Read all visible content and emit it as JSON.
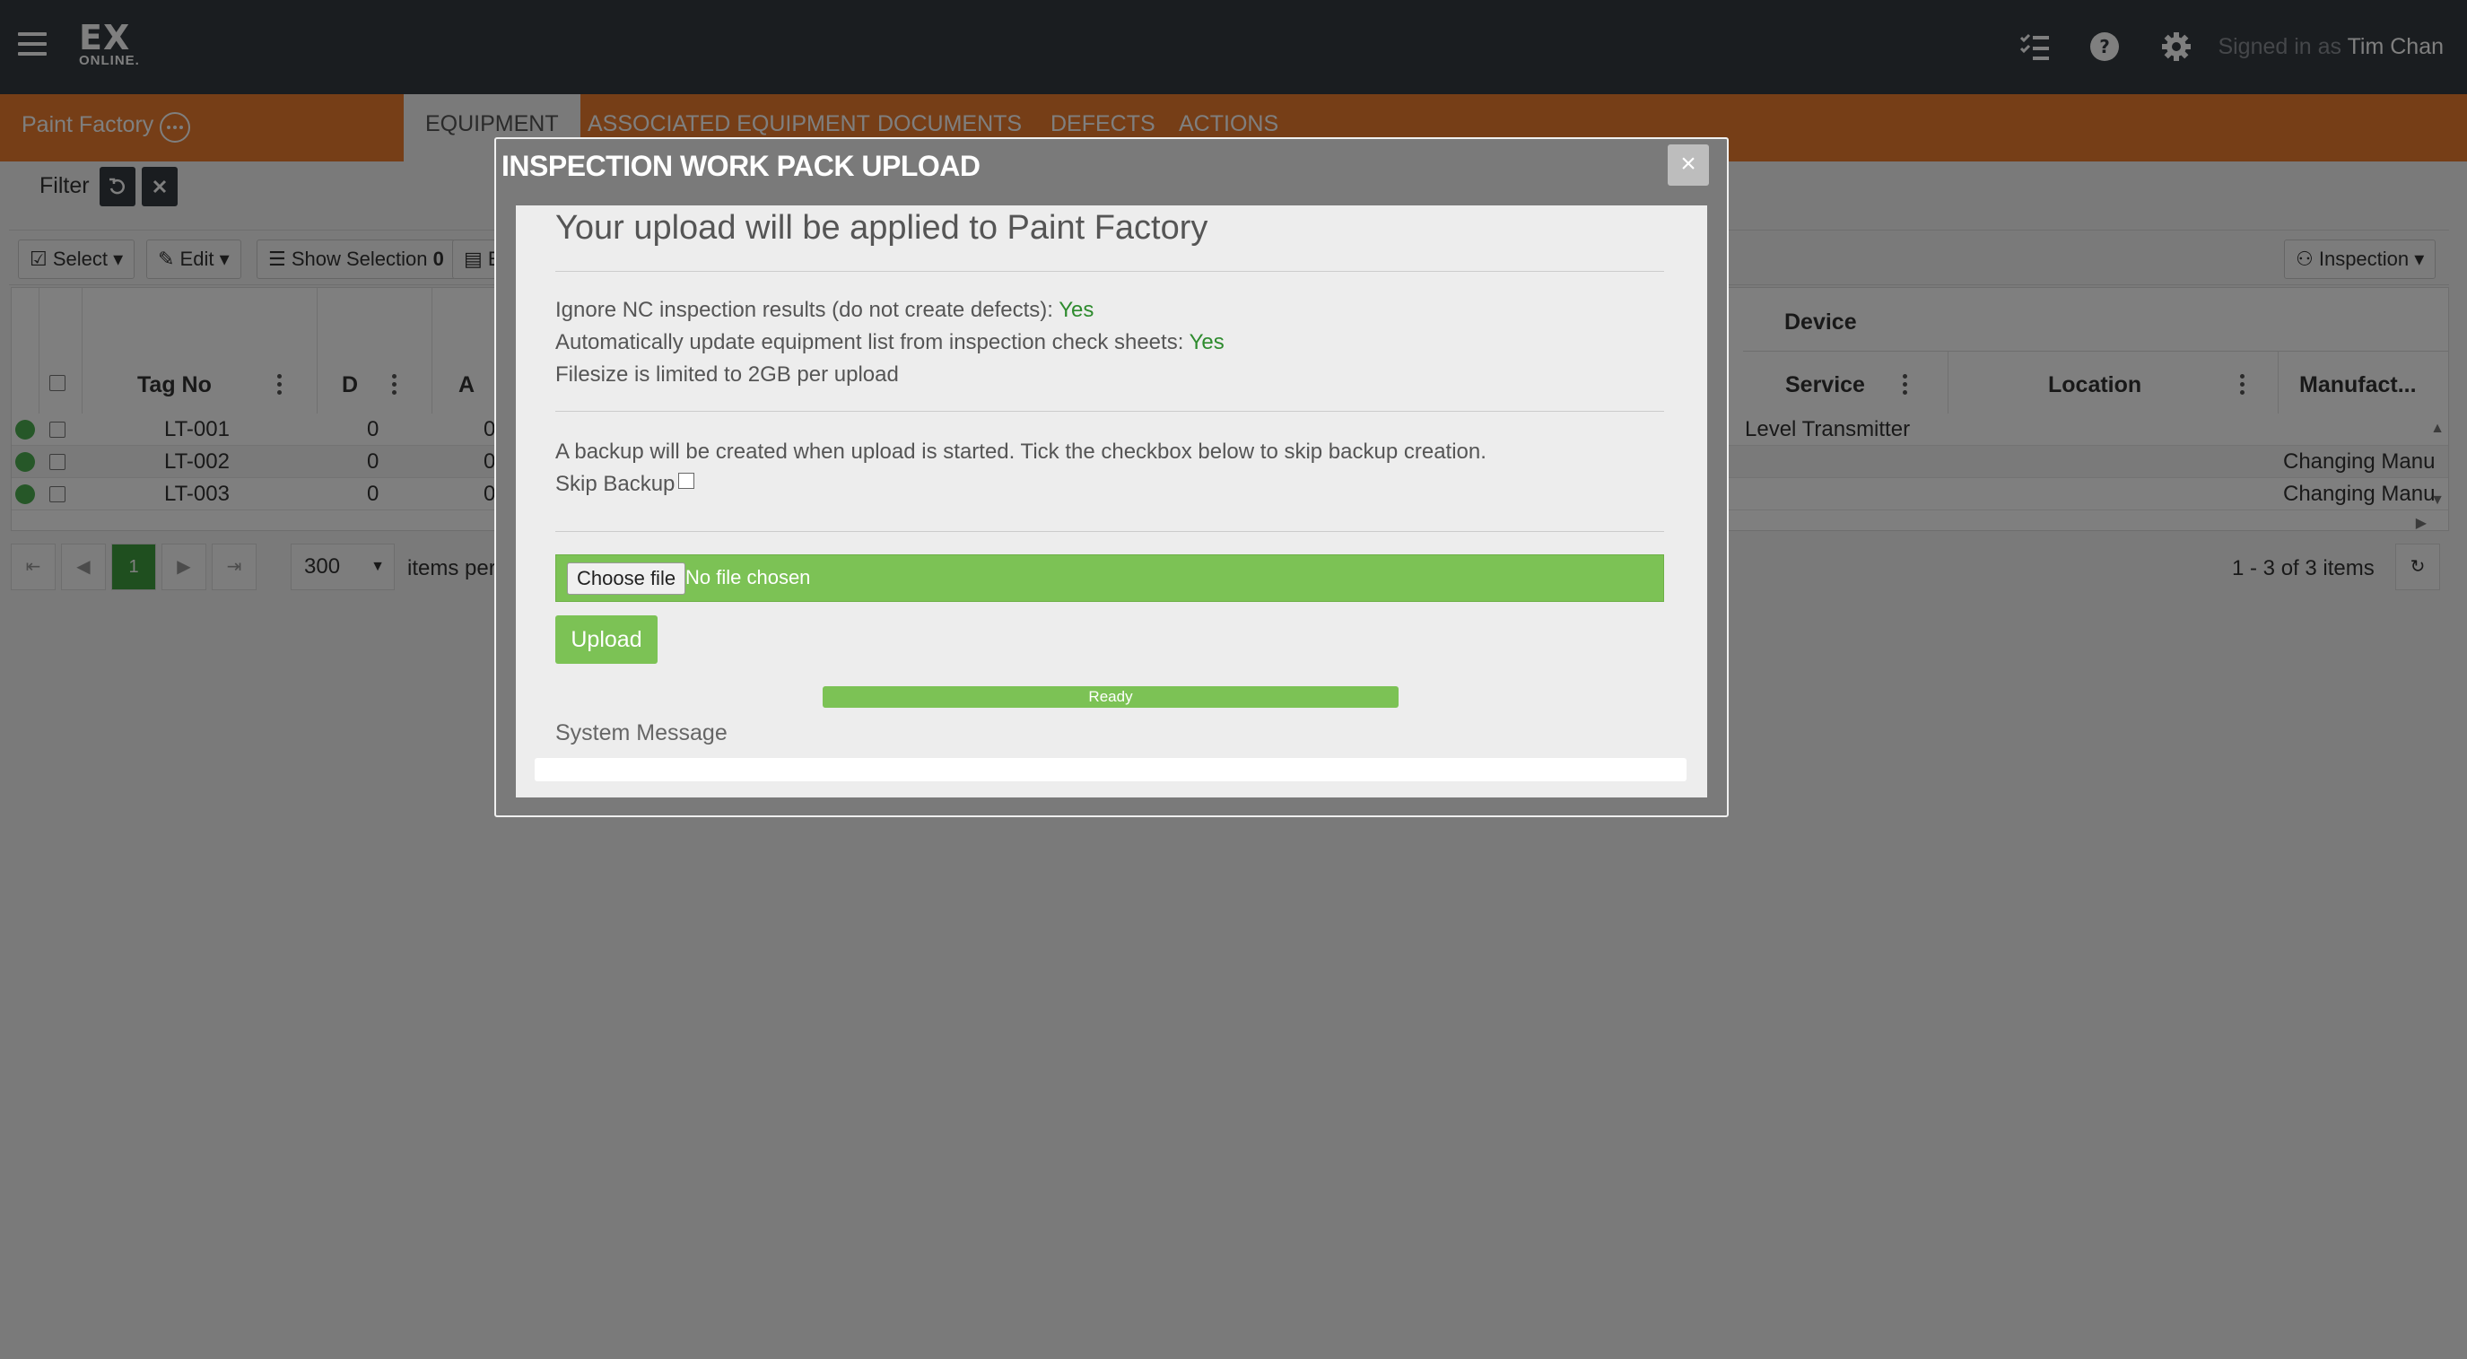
{
  "header": {
    "logo_main": "EX",
    "logo_sub": "ONLINE.",
    "signed_in_prefix": "Signed in as",
    "user_name": "Tim Chan"
  },
  "subheader": {
    "site_name": "Paint Factory",
    "tabs": [
      {
        "label": "EQUIPMENT",
        "active": true
      },
      {
        "label": "ASSOCIATED EQUIPMENT",
        "active": false
      },
      {
        "label": "DOCUMENTS",
        "active": false
      },
      {
        "label": "DEFECTS",
        "active": false
      },
      {
        "label": "ACTIONS",
        "active": false
      }
    ]
  },
  "filter": {
    "label": "Filter"
  },
  "toolbar": {
    "select_label": "Select",
    "edit_label": "Edit",
    "show_selection_label": "Show Selection",
    "show_selection_count": "0",
    "export_label": "E",
    "inspection_label": "Inspection"
  },
  "grid": {
    "group_header": "Device",
    "columns": [
      "Tag No",
      "D",
      "A",
      "Service",
      "Location",
      "Manufact..."
    ],
    "rows": [
      {
        "tag": "LT-001",
        "d": "0",
        "a": "0",
        "service": "Level Transmitter",
        "manufacturer": ""
      },
      {
        "tag": "LT-002",
        "d": "0",
        "a": "0",
        "service": "",
        "manufacturer": "Changing Manu"
      },
      {
        "tag": "LT-003",
        "d": "0",
        "a": "0",
        "service": "",
        "manufacturer": "Changing Manu"
      }
    ]
  },
  "pager": {
    "current_page": "1",
    "page_size": "300",
    "items_per_label": "items per",
    "summary": "1 - 3 of 3 items"
  },
  "modal": {
    "title": "INSPECTION WORK PACK UPLOAD",
    "close": "×",
    "heading": "Your upload will be applied to Paint Factory",
    "ignore_nc_label": "Ignore NC inspection results (do not create defects):",
    "ignore_nc_value": "Yes",
    "auto_update_label": "Automatically update equipment list from inspection check sheets:",
    "auto_update_value": "Yes",
    "filesize_note": "Filesize is limited to 2GB per upload",
    "backup_note": "A backup will be created when upload is started. Tick the checkbox below to skip backup creation.",
    "skip_backup_label": "Skip Backup",
    "choose_file_label": "Choose file",
    "no_file_label": "No file chosen",
    "upload_label": "Upload",
    "progress_label": "Ready",
    "system_message_label": "System Message"
  },
  "colors": {
    "topbar": "#343a40",
    "brand_orange": "#ec7d2f",
    "success_green": "#7cc255",
    "yes_green": "#2e8b2e"
  }
}
